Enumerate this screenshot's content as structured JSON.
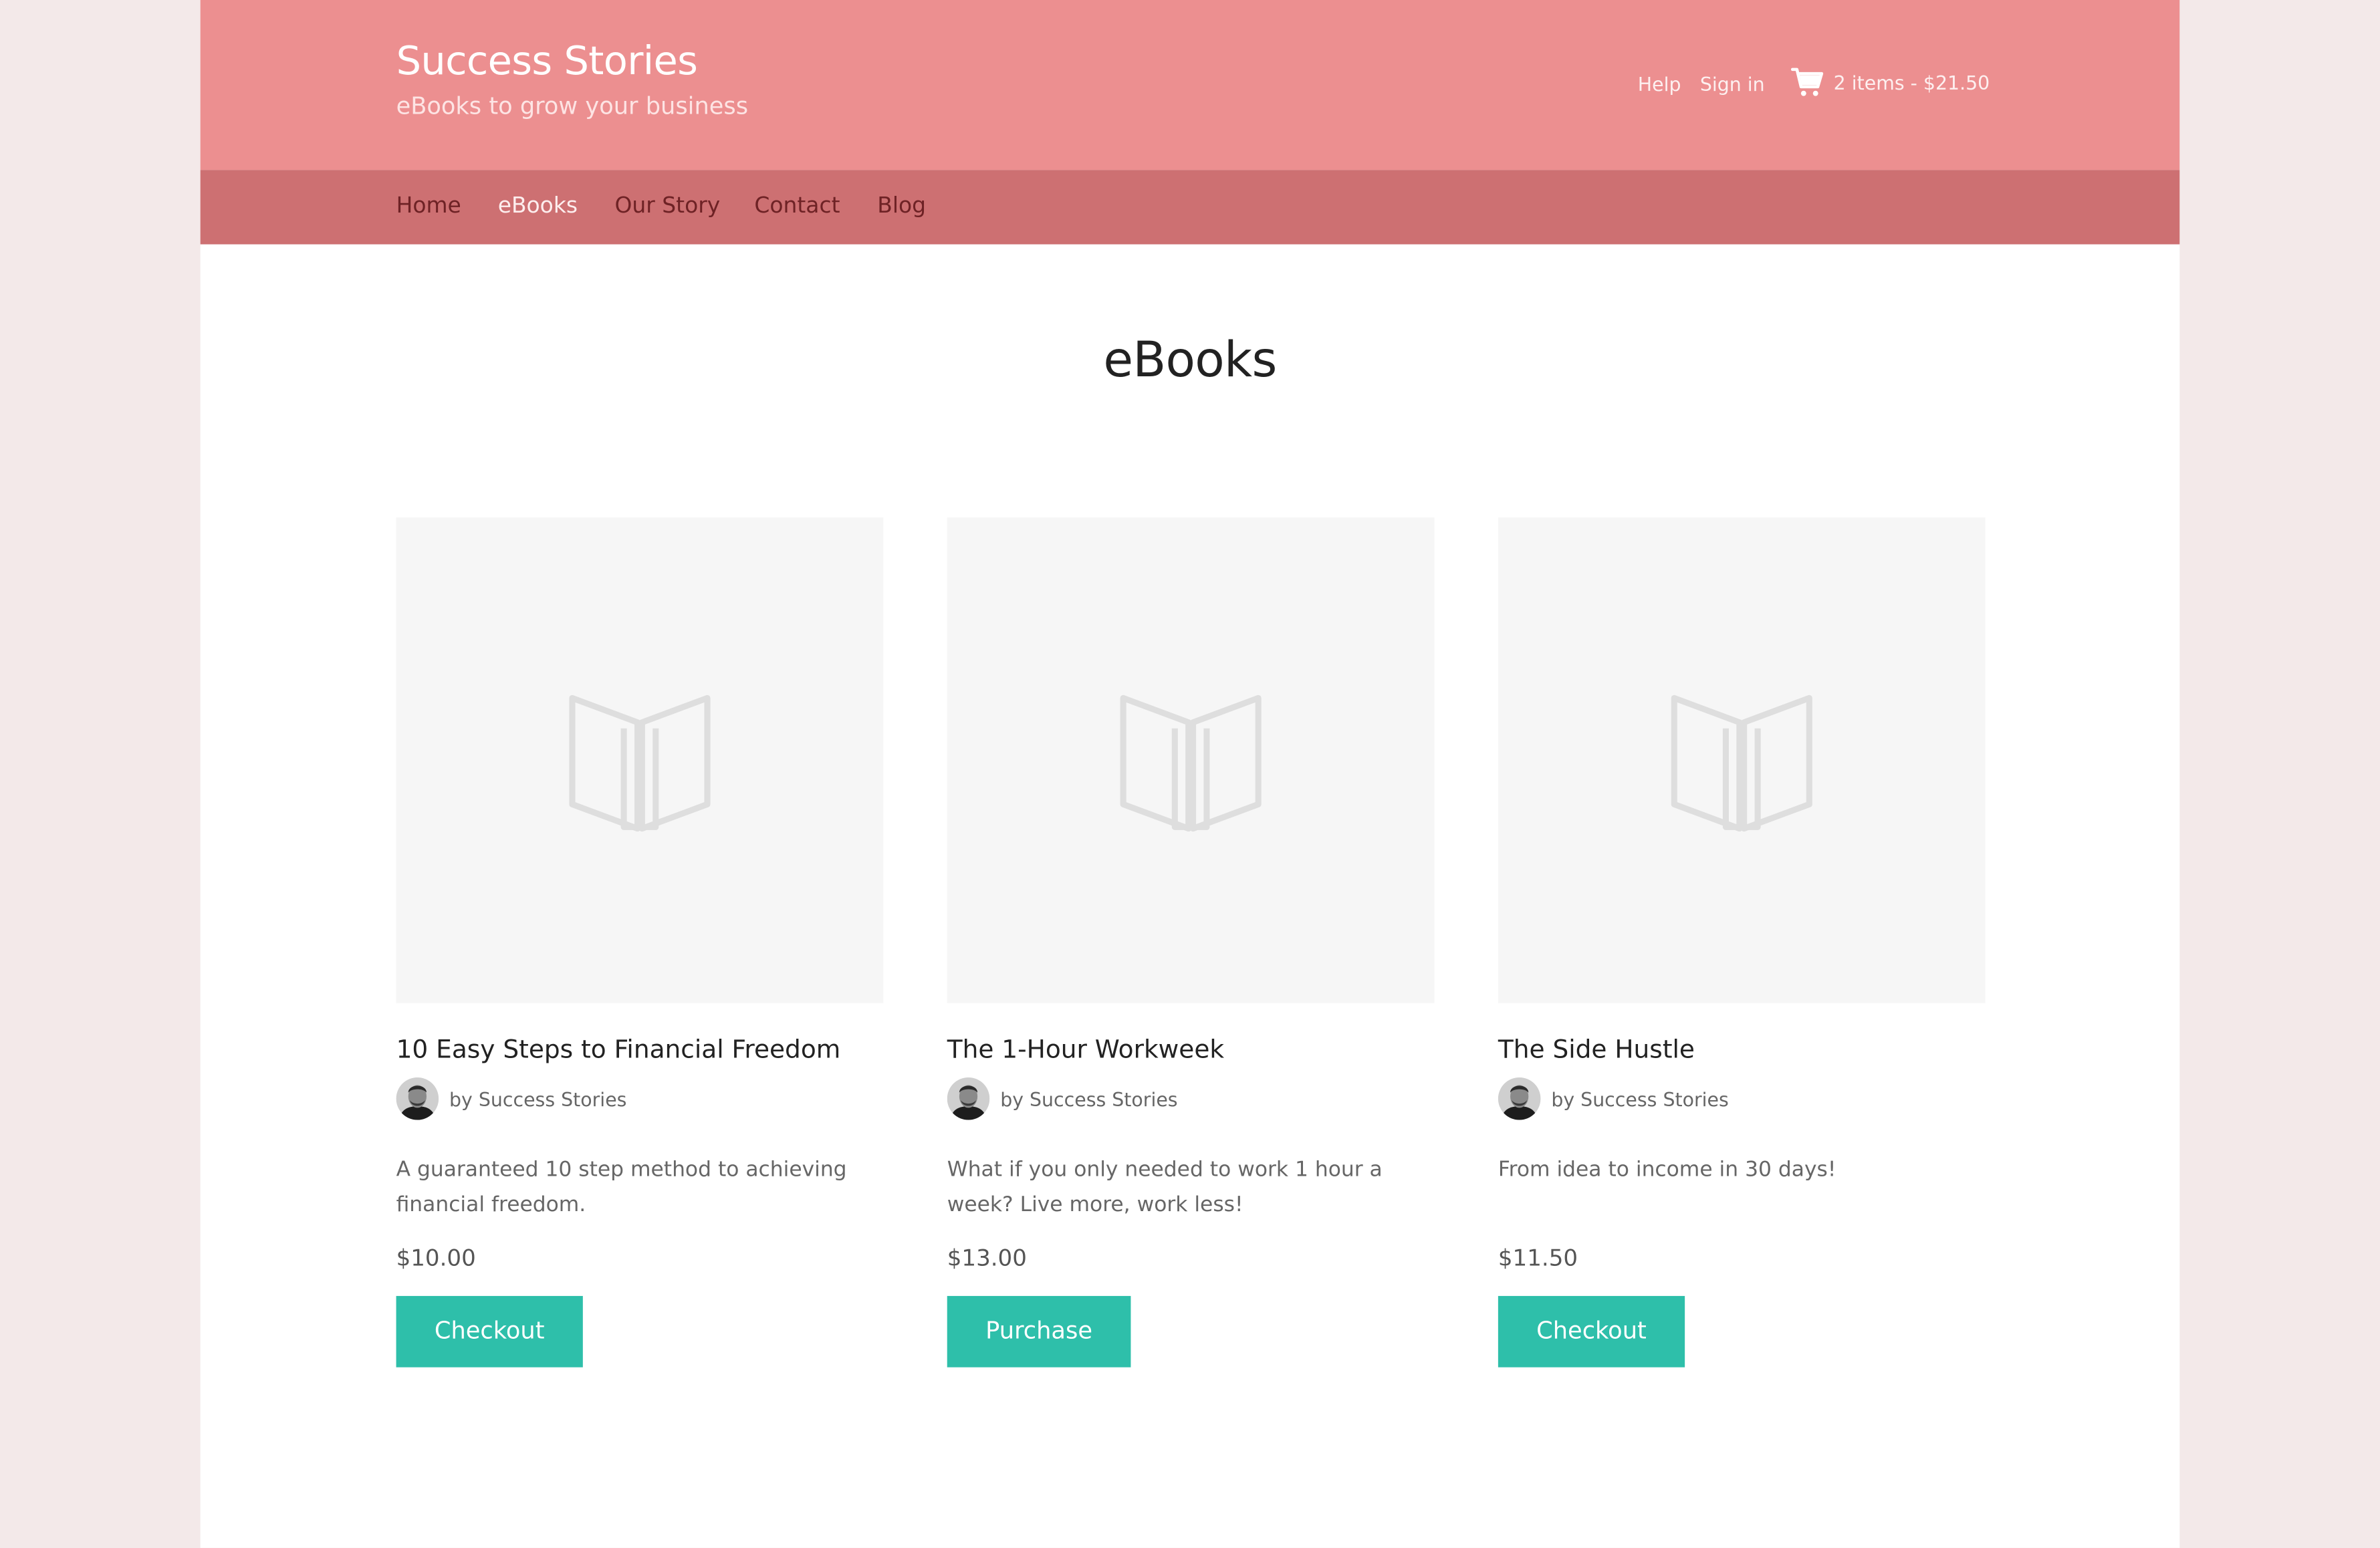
{
  "header": {
    "site_title": "Success Stories",
    "tagline": "eBooks to grow your business",
    "help_label": "Help",
    "signin_label": "Sign in",
    "cart_icon": "cart-icon",
    "cart_summary": "2 items - $21.50"
  },
  "nav": {
    "items": [
      {
        "label": "Home"
      },
      {
        "label": "eBooks",
        "active": true
      },
      {
        "label": "Our Story"
      },
      {
        "label": "Contact"
      },
      {
        "label": "Blog"
      }
    ]
  },
  "main": {
    "heading": "eBooks",
    "products": [
      {
        "image_icon": "open-book-icon",
        "title": "10 Easy Steps to Financial Freedom",
        "author": "by Success Stories",
        "description": "A guaranteed 10 step method to achieving financial freedom.",
        "price": "$10.00",
        "button_label": "Checkout"
      },
      {
        "image_icon": "open-book-icon",
        "title": "The 1-Hour Workweek",
        "author": "by Success Stories",
        "description": "What if you only needed to work 1 hour a week? Live more, work less!",
        "price": "$13.00",
        "button_label": "Purchase"
      },
      {
        "image_icon": "open-book-icon",
        "title": "The Side Hustle",
        "author": "by Success Stories",
        "description": "From idea to income in 30 days!",
        "price": "$11.50",
        "button_label": "Checkout"
      }
    ]
  },
  "colors": {
    "header_bg": "#ec8f90",
    "nav_bg": "#cd7072",
    "accent_button": "#2ebfaa",
    "page_bg": "#f3e9e9"
  }
}
